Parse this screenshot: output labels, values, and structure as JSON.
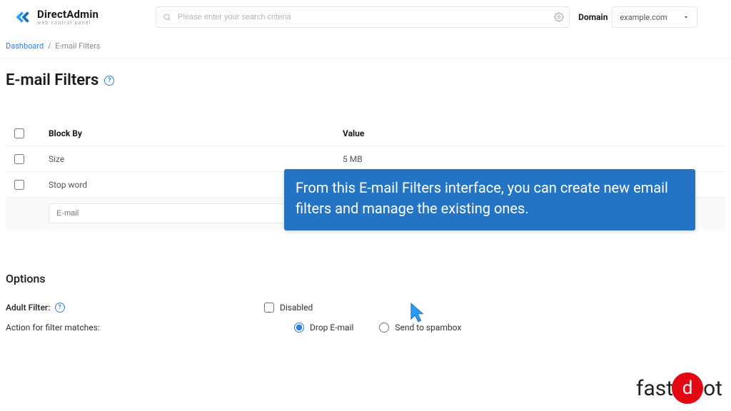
{
  "brand": {
    "title": "DirectAdmin",
    "subtitle": "web control panel"
  },
  "search": {
    "placeholder": "Please enter your search criteria"
  },
  "domain": {
    "label": "Domain",
    "value": "example.com"
  },
  "breadcrumb": {
    "dashboard": "Dashboard",
    "current": "E-mail Filters"
  },
  "page": {
    "title": "E-mail Filters"
  },
  "table": {
    "headers": {
      "block_by": "Block By",
      "value": "Value"
    },
    "rows": [
      {
        "block_by": "Size",
        "value": "5 MB"
      },
      {
        "block_by": "Stop word",
        "value": ""
      }
    ],
    "add_placeholder": "E-mail"
  },
  "options": {
    "title": "Options",
    "adult_filter": {
      "label": "Adult Filter:",
      "value": "Disabled"
    },
    "action": {
      "label": "Action for filter matches:",
      "drop": "Drop E-mail",
      "spam": "Send to spambox"
    }
  },
  "tooltip": "From this E-mail Filters interface, you can create new email filters and manage the existing ones.",
  "watermark": {
    "pre": "fast",
    "in": "d",
    "post": "ot"
  }
}
